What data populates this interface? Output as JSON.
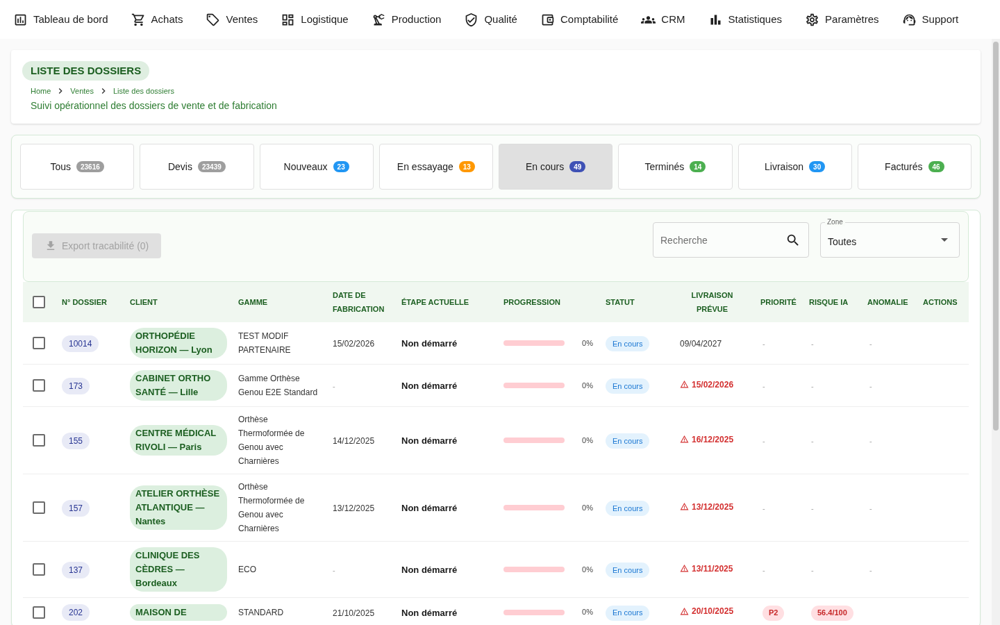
{
  "nav": [
    "Tableau de bord",
    "Achats",
    "Ventes",
    "Logistique",
    "Production",
    "Qualité",
    "Comptabilité",
    "CRM",
    "Statistiques",
    "Paramètres",
    "Support"
  ],
  "header": {
    "title": "LISTE DES DOSSIERS",
    "breadcrumb": [
      "Home",
      "Ventes",
      "Liste des dossiers"
    ],
    "subtitle": "Suivi opérationnel des dossiers de vente et de fabrication"
  },
  "tabs": [
    {
      "label": "Tous",
      "count": "23616",
      "color": "#9e9e9e",
      "selected": false
    },
    {
      "label": "Devis",
      "count": "23439",
      "color": "#9e9e9e",
      "selected": false
    },
    {
      "label": "Nouveaux",
      "count": "23",
      "color": "#2196f3",
      "selected": false
    },
    {
      "label": "En essayage",
      "count": "13",
      "color": "#ff9800",
      "selected": false
    },
    {
      "label": "En cours",
      "count": "49",
      "color": "#3f51b5",
      "selected": true
    },
    {
      "label": "Terminés",
      "count": "14",
      "color": "#4caf50",
      "selected": false
    },
    {
      "label": "Livraison",
      "count": "30",
      "color": "#2196f3",
      "selected": false
    },
    {
      "label": "Facturés",
      "count": "46",
      "color": "#4caf50",
      "selected": false
    }
  ],
  "toolbar": {
    "export_button": {
      "label": "Export tracabilité (0)",
      "disabled": true
    },
    "search": {
      "placeholder": "Recherche"
    },
    "zone": {
      "label": "Zone",
      "value": "Toutes"
    }
  },
  "table": {
    "select_all": {
      "checked": false
    },
    "columns": [
      "N° DOSSIER",
      "CLIENT",
      "GAMME",
      "DATE DE FABRICATION",
      "ÉTAPE ACTUELLE",
      "PROGRESSION",
      "STATUT",
      "LIVRAISON PRÉVUE",
      "PRIORITÉ",
      "RISQUE IA",
      "ANOMALIE",
      "ACTIONS"
    ],
    "rows": [
      {
        "checked": false,
        "dossier": "10014",
        "client": "ORTHOPÉDIE HORIZON — Lyon",
        "gamme": "TEST MODIF PARTENAIRE",
        "date_fabrication": {
          "text": "15/02/2026",
          "kind": "date"
        },
        "etape": "Non démarré",
        "progress": {
          "level": 0,
          "reading": "0%"
        },
        "statut": "En cours",
        "livraison": {
          "date": "09/04/2027",
          "late": false
        },
        "priorite": {
          "text": "-",
          "kind": "dash"
        },
        "risque_ia": {
          "text": "-",
          "kind": "dash"
        },
        "anomalie": {
          "text": "-",
          "kind": "dash"
        }
      },
      {
        "checked": false,
        "dossier": "173",
        "client": "CABINET ORTHO SANTÉ — Lille",
        "gamme": "Gamme Orthèse Genou E2E Standard",
        "date_fabrication": {
          "text": "-",
          "kind": "dash"
        },
        "etape": "Non démarré",
        "progress": {
          "level": 0,
          "reading": "0%"
        },
        "statut": "En cours",
        "livraison": {
          "date": "15/02/2026",
          "late": true
        },
        "priorite": {
          "text": "-",
          "kind": "dash"
        },
        "risque_ia": {
          "text": "-",
          "kind": "dash"
        },
        "anomalie": {
          "text": "-",
          "kind": "dash"
        }
      },
      {
        "checked": false,
        "dossier": "155",
        "client": "CENTRE MÉDICAL RIVOLI — Paris",
        "gamme": "Orthèse Thermoformée de Genou avec Charnières",
        "date_fabrication": {
          "text": "14/12/2025",
          "kind": "date"
        },
        "etape": "Non démarré",
        "progress": {
          "level": 0,
          "reading": "0%"
        },
        "statut": "En cours",
        "livraison": {
          "date": "16/12/2025",
          "late": true
        },
        "priorite": {
          "text": "-",
          "kind": "dash"
        },
        "risque_ia": {
          "text": "-",
          "kind": "dash"
        },
        "anomalie": {
          "text": "-",
          "kind": "dash"
        }
      },
      {
        "checked": false,
        "dossier": "157",
        "client": "ATELIER ORTHÈSE ATLANTIQUE — Nantes",
        "gamme": "Orthèse Thermoformée de Genou avec Charnières",
        "date_fabrication": {
          "text": "13/12/2025",
          "kind": "date"
        },
        "etape": "Non démarré",
        "progress": {
          "level": 0,
          "reading": "0%"
        },
        "statut": "En cours",
        "livraison": {
          "date": "13/12/2025",
          "late": true
        },
        "priorite": {
          "text": "-",
          "kind": "dash"
        },
        "risque_ia": {
          "text": "-",
          "kind": "dash"
        },
        "anomalie": {
          "text": "-",
          "kind": "dash"
        }
      },
      {
        "checked": false,
        "dossier": "137",
        "client": "CLINIQUE DES CÈDRES — Bordeaux",
        "gamme": "ECO",
        "date_fabrication": {
          "text": "-",
          "kind": "dash"
        },
        "etape": "Non démarré",
        "progress": {
          "level": 0,
          "reading": "0%"
        },
        "statut": "En cours",
        "livraison": {
          "date": "13/11/2025",
          "late": true
        },
        "priorite": {
          "text": "-",
          "kind": "dash"
        },
        "risque_ia": {
          "text": "-",
          "kind": "dash"
        },
        "anomalie": {
          "text": "-",
          "kind": "dash"
        }
      },
      {
        "checked": false,
        "dossier": "202",
        "client": "MAISON DE",
        "gamme": "STANDARD",
        "date_fabrication": {
          "text": "21/10/2025",
          "kind": "date"
        },
        "etape": "Non démarré",
        "progress": {
          "level": 0,
          "reading": "0%"
        },
        "statut": "En cours",
        "livraison": {
          "date": "20/10/2025",
          "late": true
        },
        "priorite": {
          "text": "P2",
          "kind": "badge"
        },
        "risque_ia": {
          "text": "56.4/100",
          "kind": "badge"
        }
      }
    ]
  }
}
